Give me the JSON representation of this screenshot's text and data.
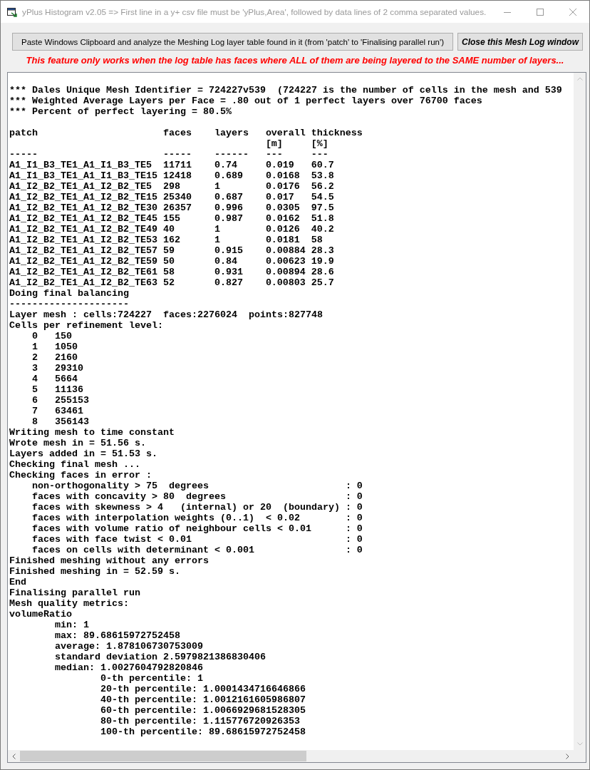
{
  "window": {
    "title": "yPlus Histogram v2.05 => First line in a y+ csv file must be 'yPlus,Area', followed by data lines of 2 comma separated values."
  },
  "buttons": [
    {
      "kind": "paste",
      "label": "Paste Windows Clipboard and analyze the Meshing Log layer table found in it (from 'patch' to 'Finalising parallel run')"
    },
    {
      "kind": "close",
      "label": "Close this Mesh Log window"
    }
  ],
  "notice": "This feature only works when the log table has faces where ALL of them are being layered to the SAME number of layers...",
  "log": {
    "summary": [
      "*** Dales Unique Mesh Identifier = 724227v539  (724227 is the number of cells in the mesh and 539",
      "*** Weighted Average Layers per Face = .80 out of 1 perfect layers over 76700 faces",
      "*** Percent of perfect layering = 80.5%"
    ],
    "table": {
      "columns": [
        {
          "label": "patch",
          "rule": "-----"
        },
        {
          "label": "faces",
          "rule": "-----"
        },
        {
          "label": "layers",
          "rule": "------"
        },
        {
          "label": "overall",
          "unit": "[m]",
          "rule": "---"
        },
        {
          "label": "thickness",
          "unit": "[%]",
          "rule": "---"
        }
      ],
      "rows": [
        [
          "A1_I1_B3_TE1_A1_I1_B3_TE5",
          "11711",
          "0.74",
          "0.019",
          "60.7"
        ],
        [
          "A1_I1_B3_TE1_A1_I1_B3_TE15",
          "12418",
          "0.689",
          "0.0168",
          "53.8"
        ],
        [
          "A1_I2_B2_TE1_A1_I2_B2_TE5",
          "298",
          "1",
          "0.0176",
          "56.2"
        ],
        [
          "A1_I2_B2_TE1_A1_I2_B2_TE15",
          "25340",
          "0.687",
          "0.017",
          "54.5"
        ],
        [
          "A1_I2_B2_TE1_A1_I2_B2_TE30",
          "26357",
          "0.996",
          "0.0305",
          "97.5"
        ],
        [
          "A1_I2_B2_TE1_A1_I2_B2_TE45",
          "155",
          "0.987",
          "0.0162",
          "51.8"
        ],
        [
          "A1_I2_B2_TE1_A1_I2_B2_TE49",
          "40",
          "1",
          "0.0126",
          "40.2"
        ],
        [
          "A1_I2_B2_TE1_A1_I2_B2_TE53",
          "162",
          "1",
          "0.0181",
          "58"
        ],
        [
          "A1_I2_B2_TE1_A1_I2_B2_TE57",
          "59",
          "0.915",
          "0.00884",
          "28.3"
        ],
        [
          "A1_I2_B2_TE1_A1_I2_B2_TE59",
          "50",
          "0.84",
          "0.00623",
          "19.9"
        ],
        [
          "A1_I2_B2_TE1_A1_I2_B2_TE61",
          "58",
          "0.931",
          "0.00894",
          "28.6"
        ],
        [
          "A1_I2_B2_TE1_A1_I2_B2_TE63",
          "52",
          "0.827",
          "0.00803",
          "25.7"
        ]
      ]
    },
    "entries": [
      {
        "kind": "line",
        "text": "Doing final balancing"
      },
      {
        "kind": "line",
        "text": "---------------------"
      },
      {
        "kind": "line",
        "text": "Layer mesh : cells:724227  faces:2276024  points:827748"
      },
      {
        "kind": "levels",
        "title": "Cells per refinement level:",
        "rows": [
          {
            "level": "0",
            "cells": "150"
          },
          {
            "level": "1",
            "cells": "1050"
          },
          {
            "level": "2",
            "cells": "2160"
          },
          {
            "level": "3",
            "cells": "29310"
          },
          {
            "level": "4",
            "cells": "5664"
          },
          {
            "level": "5",
            "cells": "11136"
          },
          {
            "level": "6",
            "cells": "255153"
          },
          {
            "level": "7",
            "cells": "63461"
          },
          {
            "level": "8",
            "cells": "356143"
          }
        ]
      },
      {
        "kind": "line",
        "text": "Writing mesh to time constant"
      },
      {
        "kind": "line",
        "text": "Wrote mesh in = 51.56 s."
      },
      {
        "kind": "line",
        "text": "Layers added in = 51.53 s."
      },
      {
        "kind": "line",
        "text": "Checking final mesh ..."
      },
      {
        "kind": "checks",
        "title": "Checking faces in error :",
        "rows": [
          {
            "test": "non-orthogonality > 75  degrees",
            "result": ": 0"
          },
          {
            "test": "faces with concavity > 80  degrees",
            "result": ": 0"
          },
          {
            "test": "faces with skewness > 4   (internal) or 20  (boundary)",
            "result": ": 0"
          },
          {
            "test": "faces with interpolation weights (0..1)  < 0.02",
            "result": ": 0"
          },
          {
            "test": "faces with volume ratio of neighbour cells < 0.01",
            "result": ": 0"
          },
          {
            "test": "faces with face twist < 0.01",
            "result": ": 0"
          },
          {
            "test": "faces on cells with determinant < 0.001",
            "result": ": 0"
          }
        ]
      },
      {
        "kind": "line",
        "text": "Finished meshing without any errors"
      },
      {
        "kind": "line",
        "text": "Finished meshing in = 52.59 s."
      },
      {
        "kind": "line",
        "text": "End"
      },
      {
        "kind": "line",
        "text": "Finalising parallel run"
      },
      {
        "kind": "line",
        "text": "Mesh quality metrics:"
      },
      {
        "kind": "line",
        "text": "volumeRatio",
        "children": [
          {
            "text": "min: 1"
          },
          {
            "text": "max: 89.68615972752458"
          },
          {
            "text": "average: 1.878106730753009"
          },
          {
            "text": "standard deviation 2.5979821386830406"
          },
          {
            "text": "median: 1.0027604792820846",
            "children": [
              {
                "text": "0-th percentile: 1"
              },
              {
                "text": "20-th percentile: 1.0001434716646866"
              },
              {
                "text": "40-th percentile: 1.0012161605986807"
              },
              {
                "text": "60-th percentile: 1.0066929681528305"
              },
              {
                "text": "80-th percentile: 1.115776720926353"
              },
              {
                "text": "100-th percentile: 89.68615972752458"
              }
            ]
          }
        ]
      }
    ]
  }
}
